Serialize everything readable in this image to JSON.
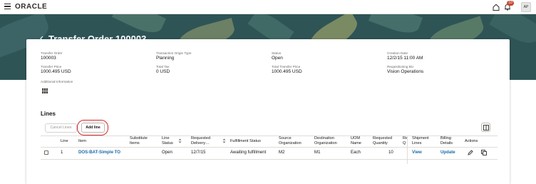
{
  "topbar": {
    "logo": "ORACLE",
    "notification_count": "10",
    "avatar_initials": "AP"
  },
  "page": {
    "title": "Transfer Order 100003"
  },
  "header_fields": [
    {
      "label": "Transfer Order",
      "value": "100003"
    },
    {
      "label": "Transaction Origin Type",
      "value": "Planning"
    },
    {
      "label": "Status",
      "value": "Open"
    },
    {
      "label": "Creation Date",
      "value": "12/2/15 11:00 AM"
    },
    {
      "label": "Transfer Price",
      "value": "1000.495 USD"
    },
    {
      "label": "Total Tax",
      "value": "0 USD"
    },
    {
      "label": "Total Transfer Price",
      "value": "1000.495 USD"
    },
    {
      "label": "Requisitioning BU",
      "value": "Vision Operations"
    },
    {
      "label": "Additional Information",
      "value": ""
    }
  ],
  "lines": {
    "title": "Lines",
    "cancel_label": "Cancel Lines",
    "add_label": "Add line",
    "columns": [
      "Line",
      "Item",
      "Substitute Items",
      "Line Status",
      "Requested Delivery…",
      "Fulfillment Status",
      "Source Organization",
      "Destination Organization",
      "UOM Name",
      "Requested Quantity",
      "Re Q",
      "Shipment Lines",
      "Billing Details",
      "Actions"
    ],
    "rows": [
      {
        "line": "1",
        "item": "DOS-BAT-Simple TO",
        "substitute": "",
        "line_status": "Open",
        "requested_delivery": "12/7/15",
        "fulfillment_status": "Awaiting fulfillment",
        "source_org": "M2",
        "destination_org": "M1",
        "uom": "Each",
        "quantity": "10",
        "shipment_lines": "View",
        "billing_details": "Update"
      }
    ]
  },
  "colors": {
    "banner": "#2e5456",
    "link": "#1b6aa5",
    "highlight": "#d4272a",
    "badge": "#c74634"
  }
}
